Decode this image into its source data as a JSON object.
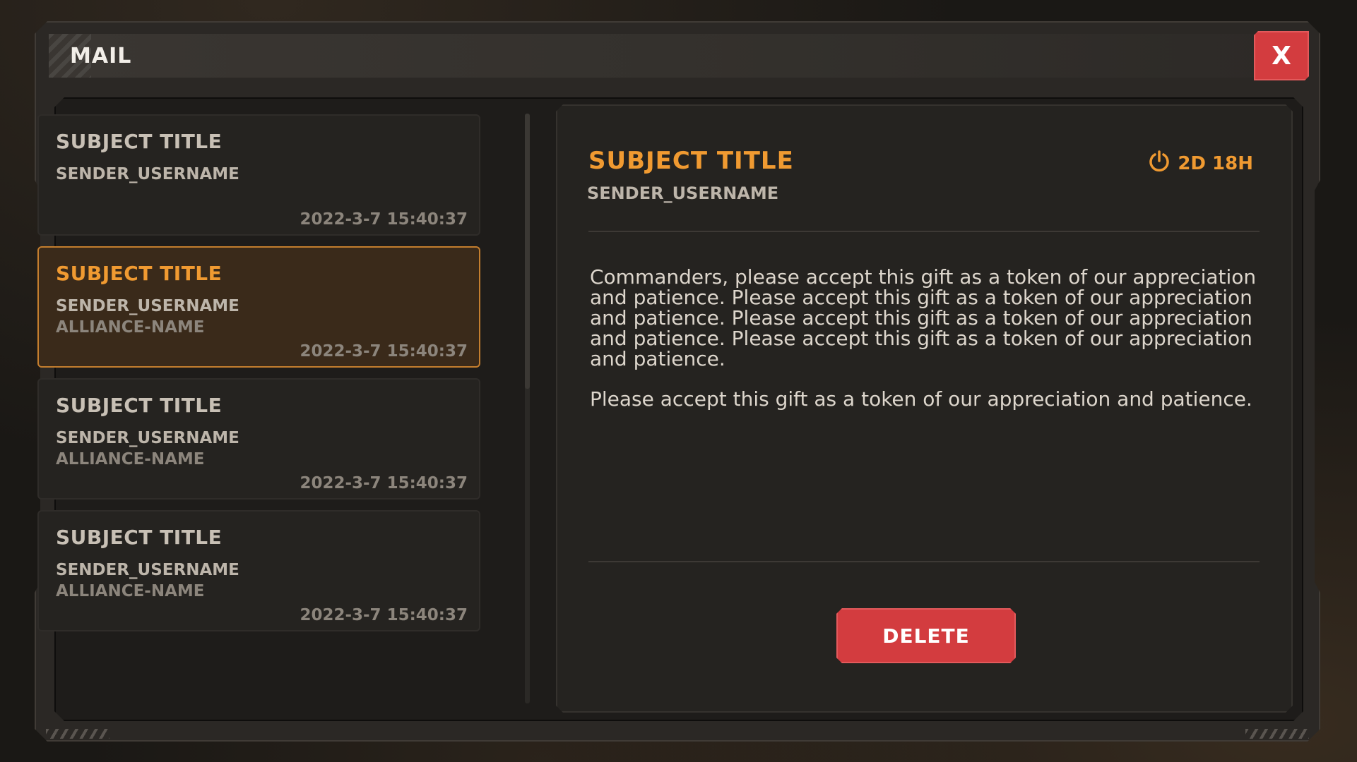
{
  "window": {
    "title": "MAIL",
    "close_label": "X"
  },
  "mail_list": [
    {
      "subject": "SUBJECT TITLE",
      "sender": "SENDER_USERNAME",
      "alliance": "",
      "date": "2022-3-7 15:40:37",
      "selected": false
    },
    {
      "subject": "SUBJECT TITLE",
      "sender": "SENDER_USERNAME",
      "alliance": "ALLIANCE-NAME",
      "date": "2022-3-7 15:40:37",
      "selected": true
    },
    {
      "subject": "SUBJECT TITLE",
      "sender": "SENDER_USERNAME",
      "alliance": "ALLIANCE-NAME",
      "date": "2022-3-7 15:40:37",
      "selected": false
    },
    {
      "subject": "SUBJECT TITLE",
      "sender": "SENDER_USERNAME",
      "alliance": "ALLIANCE-NAME",
      "date": "2022-3-7 15:40:37",
      "selected": false
    }
  ],
  "detail": {
    "subject": "SUBJECT TITLE",
    "sender": "SENDER_USERNAME",
    "timer": "2D 18H",
    "timer_icon": "power-clock-icon",
    "body": [
      "Commanders, please accept this gift as a token of our appreciation and patience. Please accept this gift as a token of our appreciation and patience. Please accept this gift as a token of our appreciation and patience. Please accept this gift as a token of our appreciation and patience.",
      "Please accept this gift as a token of our appreciation and patience."
    ],
    "delete_label": "DELETE"
  },
  "colors": {
    "accent": "#f09a31",
    "danger": "#d33c3f",
    "panel": "#252320"
  }
}
